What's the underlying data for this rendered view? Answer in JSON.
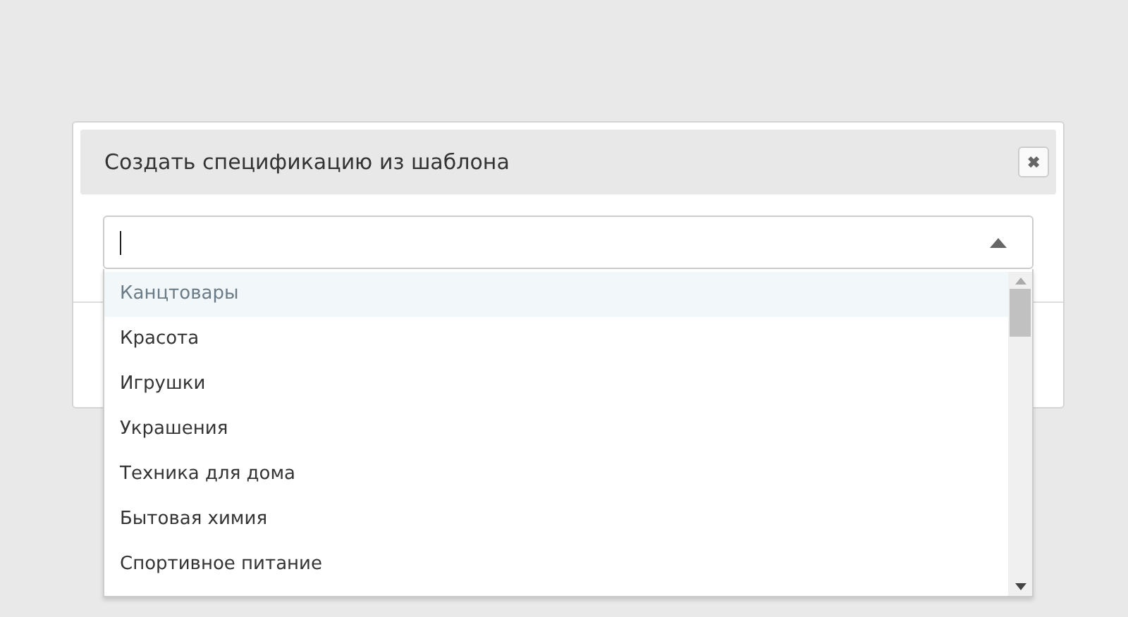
{
  "dialog": {
    "title": "Создать спецификацию из шаблона",
    "close_label": "✖"
  },
  "combobox": {
    "expanded": true,
    "options": [
      {
        "label": "Канцтовары",
        "selected": true
      },
      {
        "label": "Красота",
        "selected": false
      },
      {
        "label": "Игрушки",
        "selected": false
      },
      {
        "label": "Украшения",
        "selected": false
      },
      {
        "label": "Техника для дома",
        "selected": false
      },
      {
        "label": "Бытовая химия",
        "selected": false
      },
      {
        "label": "Спортивное питание",
        "selected": false
      }
    ]
  }
}
